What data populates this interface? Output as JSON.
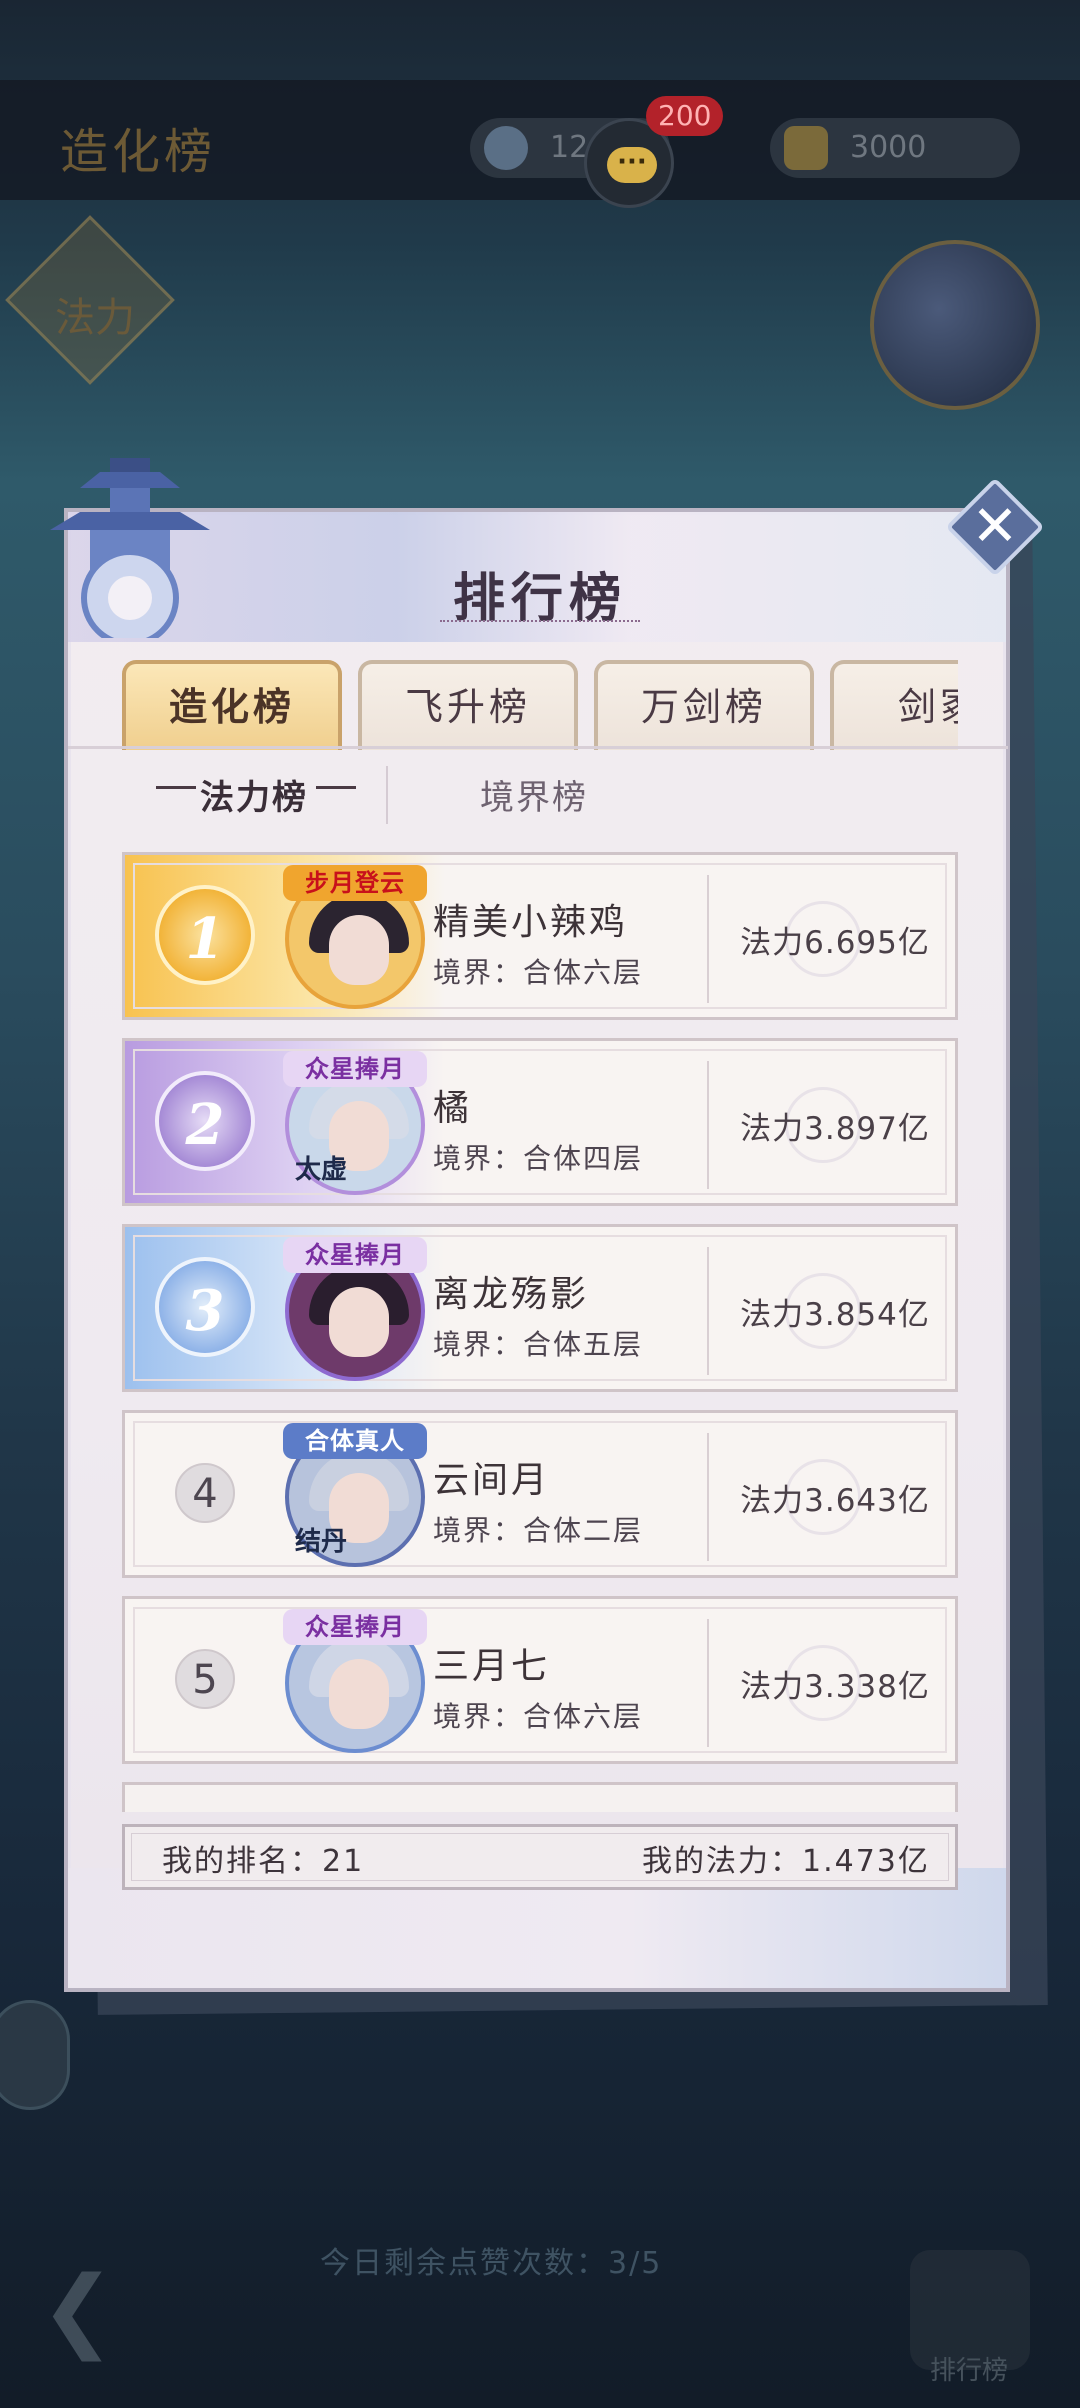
{
  "background": {
    "title": "造化榜",
    "resource_1": "12",
    "resource_2": "3000",
    "chat_badge": "200",
    "diamond_label": "法力",
    "bottom_hint": "今日剩余点赞次数：3/5",
    "right_button_label": "排行榜"
  },
  "panel": {
    "title": "排行榜",
    "tabs": [
      {
        "label": "造化榜",
        "active": true
      },
      {
        "label": "飞升榜",
        "active": false
      },
      {
        "label": "万剑榜",
        "active": false
      },
      {
        "label": "剑冢",
        "active": false
      }
    ],
    "subtabs": [
      {
        "label": "法力榜",
        "active": true
      },
      {
        "label": "境界榜",
        "active": false
      }
    ],
    "rows": [
      {
        "rank": "1",
        "badge": "步月登云",
        "name": "精美小辣鸡",
        "realm": "境界：合体六层",
        "power": "法力6.695亿"
      },
      {
        "rank": "2",
        "badge": "众星捧月",
        "corner": "太虚",
        "name": "橘",
        "realm": "境界：合体四层",
        "power": "法力3.897亿"
      },
      {
        "rank": "3",
        "badge": "众星捧月",
        "name": "离龙殇影",
        "realm": "境界：合体五层",
        "power": "法力3.854亿"
      },
      {
        "rank": "4",
        "badge": "合体真人",
        "corner": "结丹",
        "name": "云间月",
        "realm": "境界：合体二层",
        "power": "法力3.643亿"
      },
      {
        "rank": "5",
        "badge": "众星捧月",
        "name": "三月七",
        "realm": "境界：合体六层",
        "power": "法力3.338亿"
      }
    ],
    "my_rank": "我的排名：21",
    "my_power": "我的法力：1.473亿"
  },
  "icons": {
    "close": "close-icon",
    "chat": "chat-icon",
    "back": "back-arrow-icon"
  },
  "colors": {
    "gold_tab": "#f0cf8e",
    "rank1": "#f7c44a",
    "rank2": "#a68bd6",
    "rank3": "#8fb3e8"
  }
}
